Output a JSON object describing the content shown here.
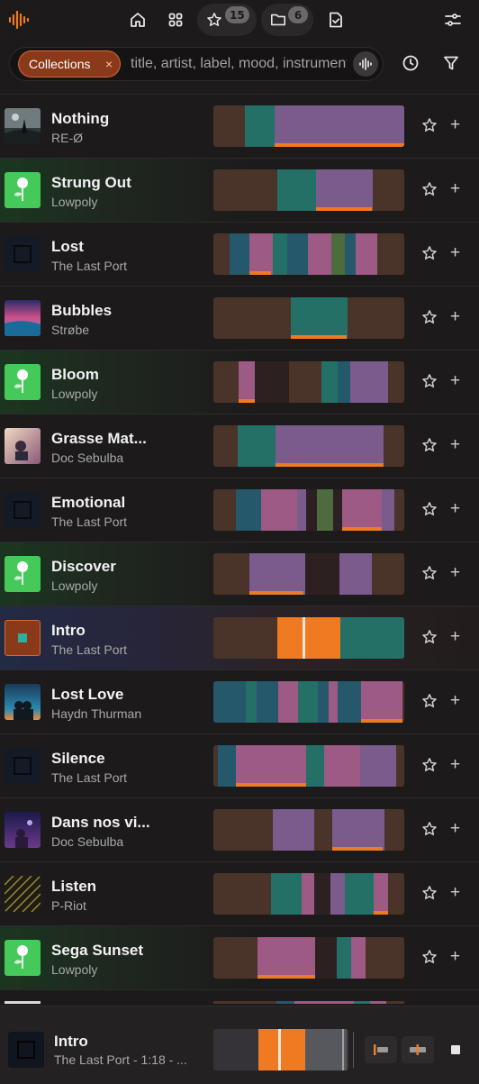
{
  "toolbar": {
    "favorites_count": "15",
    "folders_count": "6",
    "accent_color": "#f07a22"
  },
  "search": {
    "chip_label": "Collections",
    "chip_close": "×",
    "placeholder": "title, artist, label, mood, instrument"
  },
  "tracks": [
    {
      "title": "Nothing",
      "artist": "RE-Ø"
    },
    {
      "title": "Strung Out",
      "artist": "Lowpoly"
    },
    {
      "title": "Lost",
      "artist": "The Last Port"
    },
    {
      "title": "Bubbles",
      "artist": "Strøbe"
    },
    {
      "title": "Bloom",
      "artist": "Lowpoly"
    },
    {
      "title": "Grasse Mat...",
      "artist": "Doc Sebulba"
    },
    {
      "title": "Emotional",
      "artist": "The Last Port"
    },
    {
      "title": "Discover",
      "artist": "Lowpoly"
    },
    {
      "title": "Intro",
      "artist": "The Last Port"
    },
    {
      "title": "Lost Love",
      "artist": "Haydn Thurman"
    },
    {
      "title": "Silence",
      "artist": "The Last Port"
    },
    {
      "title": "Dans nos vi...",
      "artist": "Doc Sebulba"
    },
    {
      "title": "Listen",
      "artist": "P-Riot"
    },
    {
      "title": "Sega Sunset",
      "artist": "Lowpoly"
    }
  ],
  "player": {
    "title": "Intro",
    "subtitle": "The Last Port - 1:18 - ..."
  }
}
